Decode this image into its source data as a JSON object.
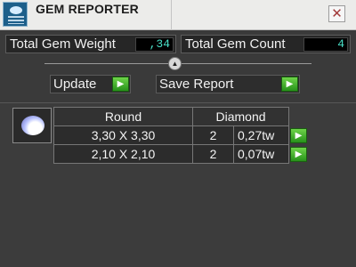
{
  "window": {
    "title": "GEM REPORTER",
    "close_symbol": "✕"
  },
  "stats": {
    "total_weight_label": "Total Gem Weight",
    "total_weight_value": ",34",
    "total_count_label": "Total Gem Count",
    "total_count_value": "4"
  },
  "controls": {
    "collapse_symbol": "▲",
    "update_label": "Update",
    "save_label": "Save Report",
    "go_symbol": "▶"
  },
  "gem_table": {
    "shape": "Round",
    "material": "Diamond",
    "rows": [
      {
        "size": "3,30 X 3,30",
        "count": "2",
        "weight": "0,27tw"
      },
      {
        "size": "2,10 X 2,10",
        "count": "2",
        "weight": "0,07tw"
      }
    ]
  },
  "icons": {
    "app": "gem-reporter-app-icon",
    "thumbnail": "round-diamond-icon",
    "go": "green-play-arrow-icon",
    "collapse": "chevron-up-icon"
  },
  "colors": {
    "accent_green": "#3db52a",
    "value_text": "#48e0c8",
    "panel_bg": "#3a3a3a"
  }
}
